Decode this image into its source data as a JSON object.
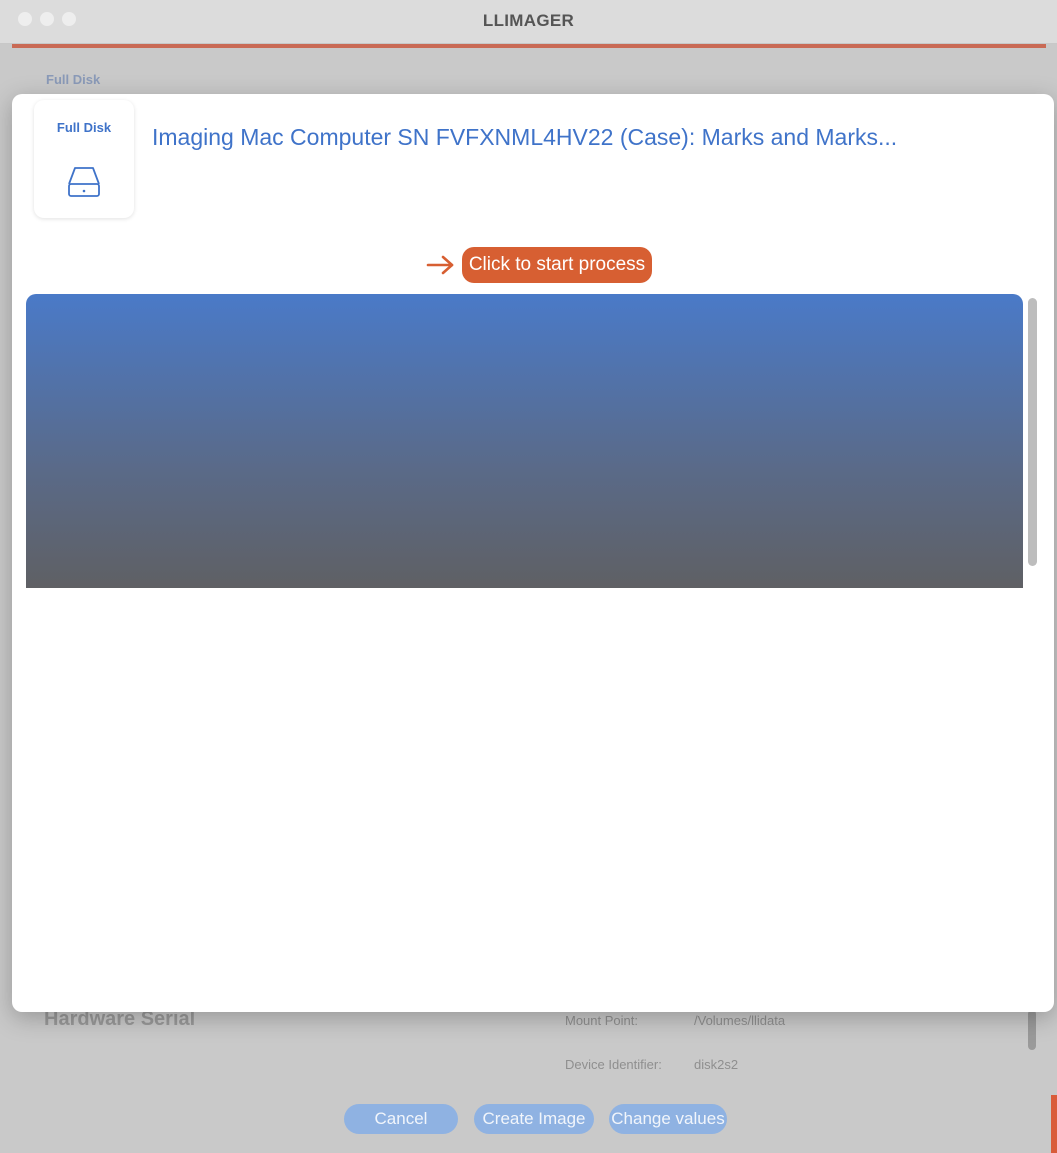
{
  "window": {
    "title": "LLIMAGER"
  },
  "background": {
    "tab_label": "Full Disk",
    "hardware_label": "Hardware Serial",
    "rows": [
      {
        "label": "Mount Point:",
        "value": "/Volumes/llidata"
      },
      {
        "label": "Device Identifier:",
        "value": "disk2s2"
      }
    ],
    "buttons": {
      "cancel": "Cancel",
      "create": "Create Image",
      "change": "Change values"
    }
  },
  "sheet": {
    "disk_card_label": "Full Disk",
    "disk_icon": "hard-drive-icon",
    "title": "Imaging Mac Computer SN FVFXNML4HV22 (Case): Marks and Marks...",
    "start_button": "Click to start process",
    "arrow_icon": "arrow-right-icon"
  },
  "colors": {
    "accent_blue": "#3f73c9",
    "start_orange": "#d75f32"
  }
}
